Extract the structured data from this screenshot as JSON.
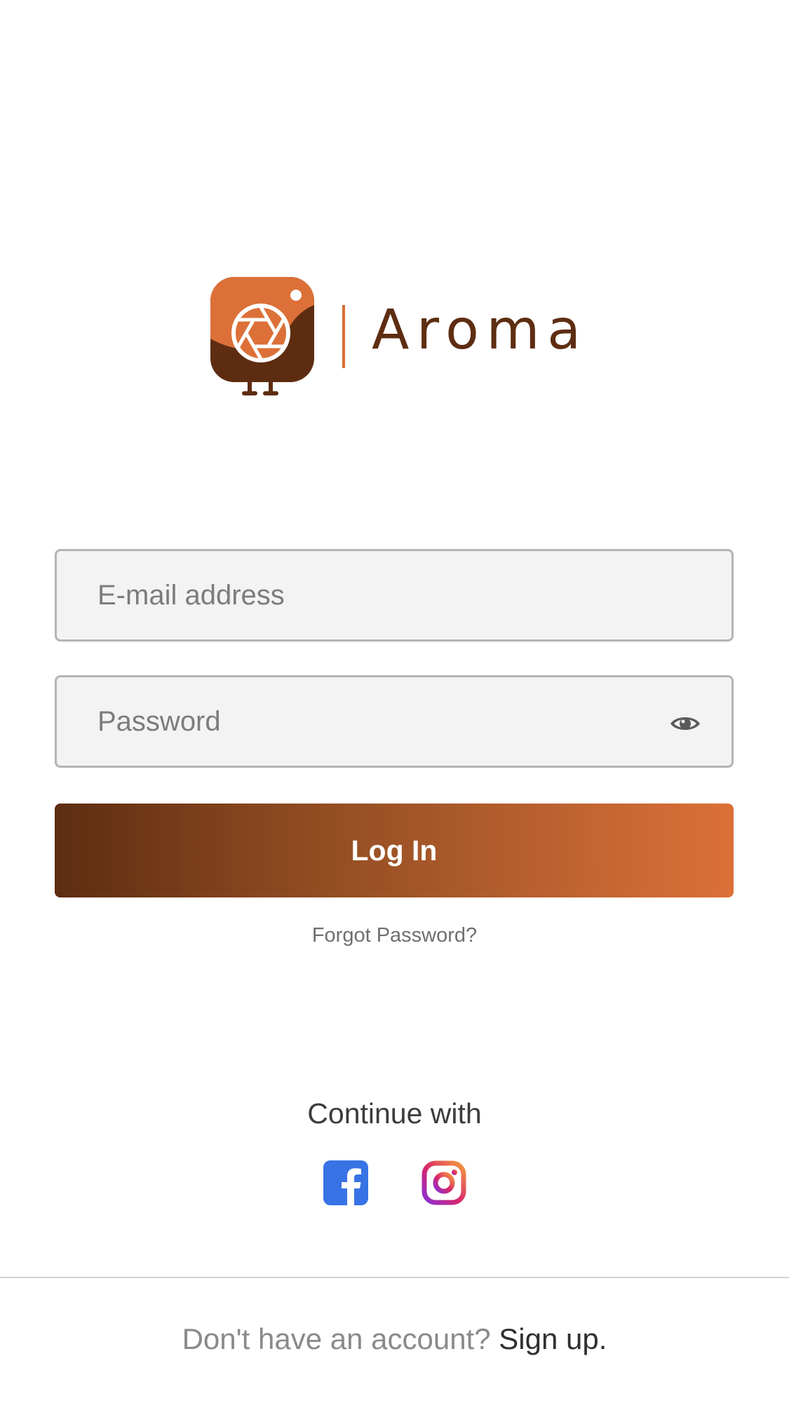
{
  "brand": {
    "name": "Aroma",
    "primary_color": "#5e2d11",
    "accent_color": "#dc7038",
    "logo_icon": "camera-aperture-bird-icon"
  },
  "login_form": {
    "email_placeholder": "E-mail address",
    "password_placeholder": "Password",
    "show_password_icon": "eye-icon",
    "login_label": "Log In",
    "forgot_password": "Forgot Password?"
  },
  "social_login": {
    "label": "Continue with",
    "providers": [
      {
        "name": "Facebook",
        "icon": "facebook-icon",
        "color": "#3873e6"
      },
      {
        "name": "Instagram",
        "icon": "instagram-icon",
        "color": "#c13584"
      }
    ]
  },
  "signup": {
    "prompt": "Don't have an account?",
    "link": "Sign up."
  }
}
